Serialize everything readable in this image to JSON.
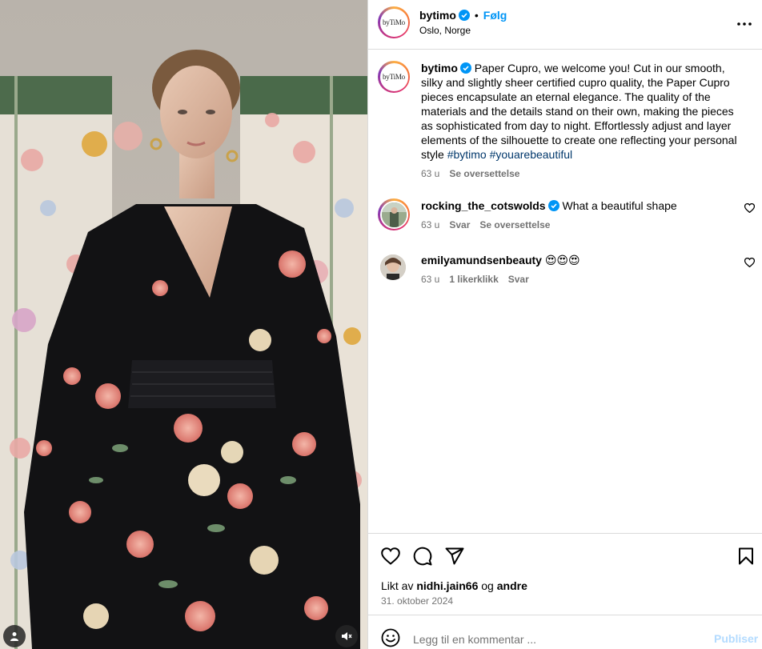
{
  "post": {
    "author": "bytimo",
    "avatar_text": "byTiMo",
    "follow_label": "Følg",
    "location": "Oslo, Norge",
    "caption_text": "Paper Cupro, we welcome you! Cut in our smooth, silky and slightly sheer certified cupro quality, the Paper Cupro pieces encapsulate an eternal elegance. The quality of the materials and the details stand on their own, making the pieces as sophisticated from day to night. Effortlessly adjust and layer elements of the silhouette to create one reflecting your personal style",
    "hashtags": [
      "#bytimo",
      "#youarebeautiful"
    ],
    "caption_age": "63 u",
    "caption_translate": "Se oversettelse"
  },
  "comments": [
    {
      "username": "rocking_the_cotswolds",
      "verified": true,
      "text": "What a beautiful shape",
      "age": "63 u",
      "reply": "Svar",
      "translate": "Se oversettelse"
    },
    {
      "username": "emilyamundsenbeauty",
      "verified": false,
      "text": "😍😍😍",
      "age": "63 u",
      "likes": "1 likerklikk",
      "reply": "Svar"
    }
  ],
  "footer": {
    "liked_prefix": "Likt av",
    "liked_user": "nidhi.jain66",
    "liked_and": "og",
    "liked_others": "andre",
    "date": "31. oktober 2024",
    "comment_placeholder": "Legg til en kommentar ...",
    "publish_label": "Publiser"
  },
  "colors": {
    "accent": "#0095f6",
    "verified": "#0095f6",
    "publish_disabled": "#b3dbff",
    "secondary_text": "#737373",
    "hashtag": "#00376b"
  },
  "icons": {
    "media": [
      "user-tag-icon",
      "mute-icon"
    ],
    "header": [
      "verified-icon",
      "more-options-icon"
    ],
    "actions": [
      "heart-icon",
      "comment-icon",
      "share-icon",
      "bookmark-icon",
      "emoji-icon"
    ]
  }
}
